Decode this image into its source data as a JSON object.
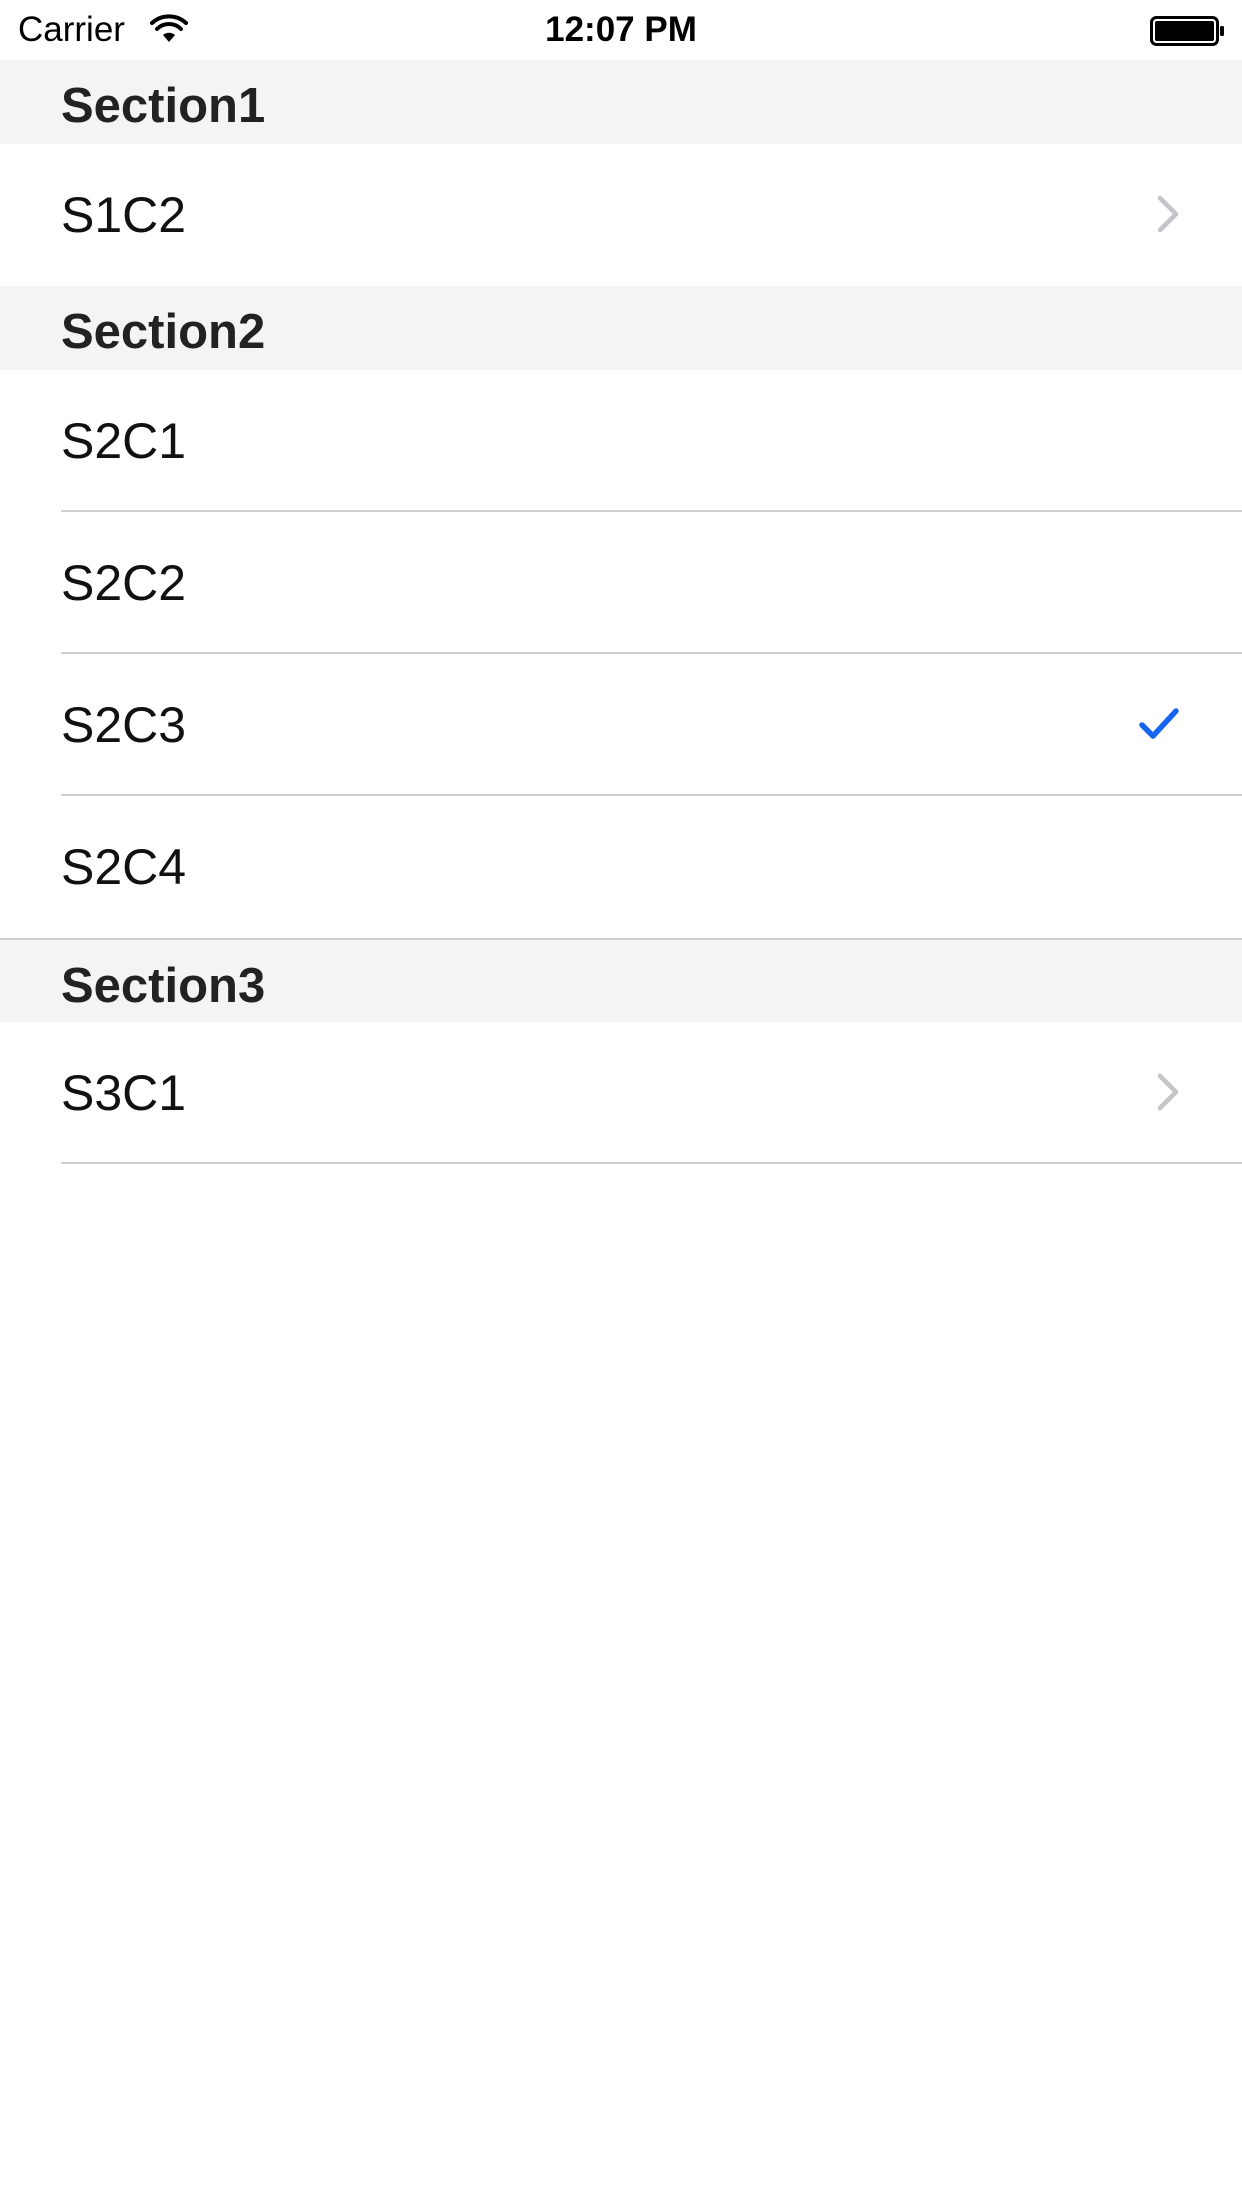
{
  "status_bar": {
    "carrier": "Carrier",
    "time": "12:07 PM",
    "wifi_icon": "wifi-icon",
    "battery_icon": "battery-icon"
  },
  "sections": [
    {
      "title": "Section1",
      "cells": [
        {
          "label": "S1C2",
          "accessory": "chevron-right-icon"
        }
      ]
    },
    {
      "title": "Section2",
      "cells": [
        {
          "label": "S2C1",
          "accessory": ""
        },
        {
          "label": "S2C2",
          "accessory": ""
        },
        {
          "label": "S2C3",
          "accessory": "checkmark-icon"
        },
        {
          "label": "S2C4",
          "accessory": ""
        }
      ]
    },
    {
      "title": "Section3",
      "cells": [
        {
          "label": "S3C1",
          "accessory": "chevron-right-icon"
        }
      ]
    }
  ],
  "colors": {
    "accent": "#1565f0",
    "chevron": "#c4c4c9",
    "section_bg": "#f4f4f4",
    "separator": "#d0d0d4"
  }
}
